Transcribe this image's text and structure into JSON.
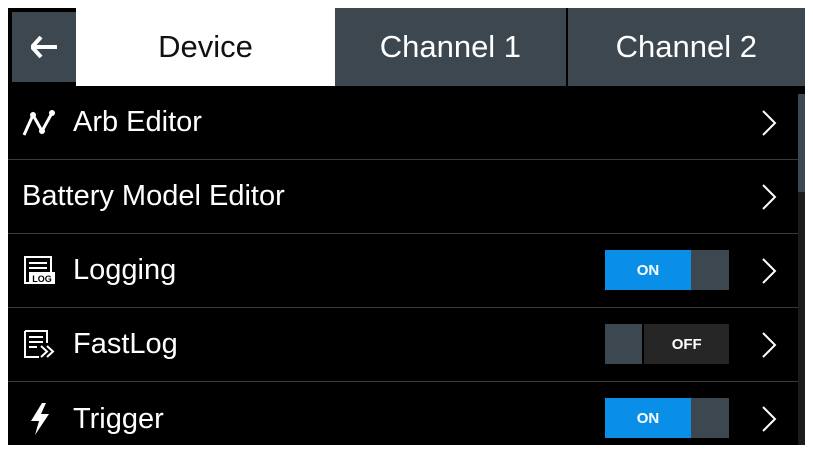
{
  "tabs": {
    "back_icon": "arrow-left-icon",
    "items": [
      {
        "label": "Device",
        "active": true
      },
      {
        "label": "Channel 1",
        "active": false
      },
      {
        "label": "Channel 2",
        "active": false
      }
    ]
  },
  "menu": {
    "items": [
      {
        "label": "Arb Editor",
        "icon": "arb-waveform-icon"
      },
      {
        "label": "Battery Model Editor",
        "icon": null
      },
      {
        "label": "Logging",
        "icon": "log-icon",
        "toggle": "ON"
      },
      {
        "label": "FastLog",
        "icon": "fastlog-icon",
        "toggle": "OFF"
      },
      {
        "label": "Trigger",
        "icon": "lightning-icon",
        "toggle": "ON"
      }
    ]
  },
  "colors": {
    "accent_on": "#0a8fe8",
    "tab_inactive": "#3c474f",
    "background": "#000000"
  }
}
